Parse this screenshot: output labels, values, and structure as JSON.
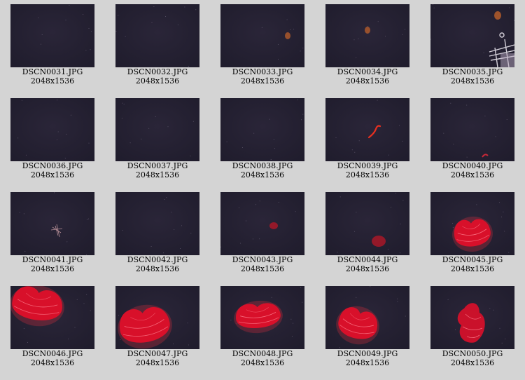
{
  "thumbnails": [
    {
      "filename": "DSCN0031.JPG",
      "dimensions": "2048x1536",
      "subject": "dark-water"
    },
    {
      "filename": "DSCN0032.JPG",
      "dimensions": "2048x1536",
      "subject": "dark-water"
    },
    {
      "filename": "DSCN0033.JPG",
      "dimensions": "2048x1536",
      "subject": "small-orange-speck"
    },
    {
      "filename": "DSCN0034.JPG",
      "dimensions": "2048x1536",
      "subject": "small-orange-speck"
    },
    {
      "filename": "DSCN0035.JPG",
      "dimensions": "2048x1536",
      "subject": "equipment-corner"
    },
    {
      "filename": "DSCN0036.JPG",
      "dimensions": "2048x1536",
      "subject": "dark-water"
    },
    {
      "filename": "DSCN0037.JPG",
      "dimensions": "2048x1536",
      "subject": "dark-water"
    },
    {
      "filename": "DSCN0038.JPG",
      "dimensions": "2048x1536",
      "subject": "dark-water"
    },
    {
      "filename": "DSCN0039.JPG",
      "dimensions": "2048x1536",
      "subject": "red-worm"
    },
    {
      "filename": "DSCN0040.JPG",
      "dimensions": "2048x1536",
      "subject": "small-red-speck"
    },
    {
      "filename": "DSCN0041.JPG",
      "dimensions": "2048x1536",
      "subject": "shrimp"
    },
    {
      "filename": "DSCN0042.JPG",
      "dimensions": "2048x1536",
      "subject": "dark-water"
    },
    {
      "filename": "DSCN0043.JPG",
      "dimensions": "2048x1536",
      "subject": "small-red-blob"
    },
    {
      "filename": "DSCN0044.JPG",
      "dimensions": "2048x1536",
      "subject": "small-red-blob"
    },
    {
      "filename": "DSCN0045.JPG",
      "dimensions": "2048x1536",
      "subject": "red-jellyfish"
    },
    {
      "filename": "DSCN0046.JPG",
      "dimensions": "2048x1536",
      "subject": "red-jellyfish"
    },
    {
      "filename": "DSCN0047.JPG",
      "dimensions": "2048x1536",
      "subject": "red-jellyfish"
    },
    {
      "filename": "DSCN0048.JPG",
      "dimensions": "2048x1536",
      "subject": "red-jellyfish"
    },
    {
      "filename": "DSCN0049.JPG",
      "dimensions": "2048x1536",
      "subject": "red-jellyfish"
    },
    {
      "filename": "DSCN0050.JPG",
      "dimensions": "2048x1536",
      "subject": "red-jellyfish-folded"
    }
  ],
  "colors": {
    "background": "#d4d4d4",
    "photo_water": "#1f1c2c",
    "jelly_red": "#d8102a",
    "speck_orange": "#c8642a"
  }
}
